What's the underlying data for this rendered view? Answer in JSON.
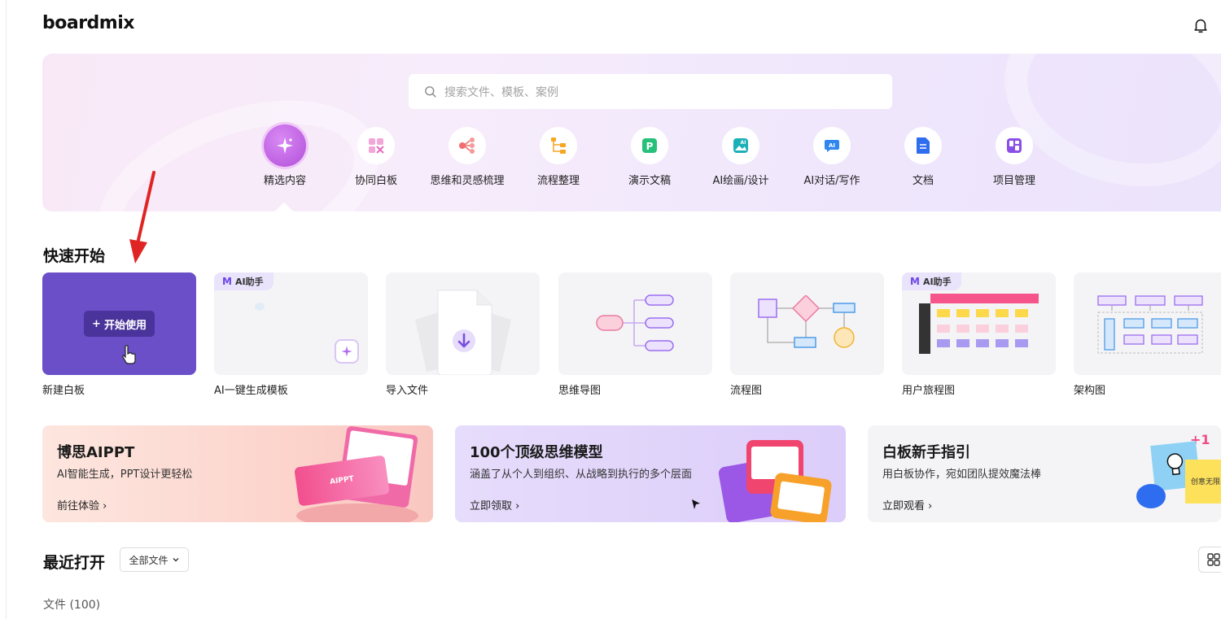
{
  "header": {
    "logo": "boardmix"
  },
  "search": {
    "placeholder": "搜索文件、模板、案例"
  },
  "categories": [
    {
      "label": "精选内容",
      "icon": "sparkle-icon",
      "active": true
    },
    {
      "label": "协同白板",
      "icon": "whiteboard-icon"
    },
    {
      "label": "思维和灵感梳理",
      "icon": "mindmap-icon"
    },
    {
      "label": "流程整理",
      "icon": "flowchart-icon"
    },
    {
      "label": "演示文稿",
      "icon": "presentation-icon"
    },
    {
      "label": "AI绘画/设计",
      "icon": "ai-image-icon"
    },
    {
      "label": "AI对话/写作",
      "icon": "ai-chat-icon"
    },
    {
      "label": "文档",
      "icon": "document-icon"
    },
    {
      "label": "项目管理",
      "icon": "project-board-icon"
    }
  ],
  "quick_start": {
    "title": "快速开始",
    "start_button": "开始使用",
    "ai_badge": "AI助手",
    "cards": [
      {
        "label": "新建白板"
      },
      {
        "label": "AI一键生成模板"
      },
      {
        "label": "导入文件"
      },
      {
        "label": "思维导图"
      },
      {
        "label": "流程图"
      },
      {
        "label": "用户旅程图"
      },
      {
        "label": "架构图"
      }
    ]
  },
  "banners": [
    {
      "title": "博思AIPPT",
      "subtitle": "AI智能生成，PPT设计更轻松",
      "link": "前往体验",
      "art_text": "AIPPT"
    },
    {
      "title": "100个顶级思维模型",
      "subtitle": "涵盖了从个人到组织、从战略到执行的多个层面",
      "link": "立即领取"
    },
    {
      "title": "白板新手指引",
      "subtitle": "用白板协作，宛如团队提效魔法棒",
      "link": "立即观看",
      "art_text": "创意无限",
      "badge": "+1"
    }
  ],
  "recent": {
    "title": "最近打开",
    "filter": "全部文件",
    "files_count": "文件 (100)"
  },
  "colors": {
    "accent": "#6a4fc8",
    "hero_bg": "#f3e8fb",
    "card_bg": "#f4f4f6"
  }
}
